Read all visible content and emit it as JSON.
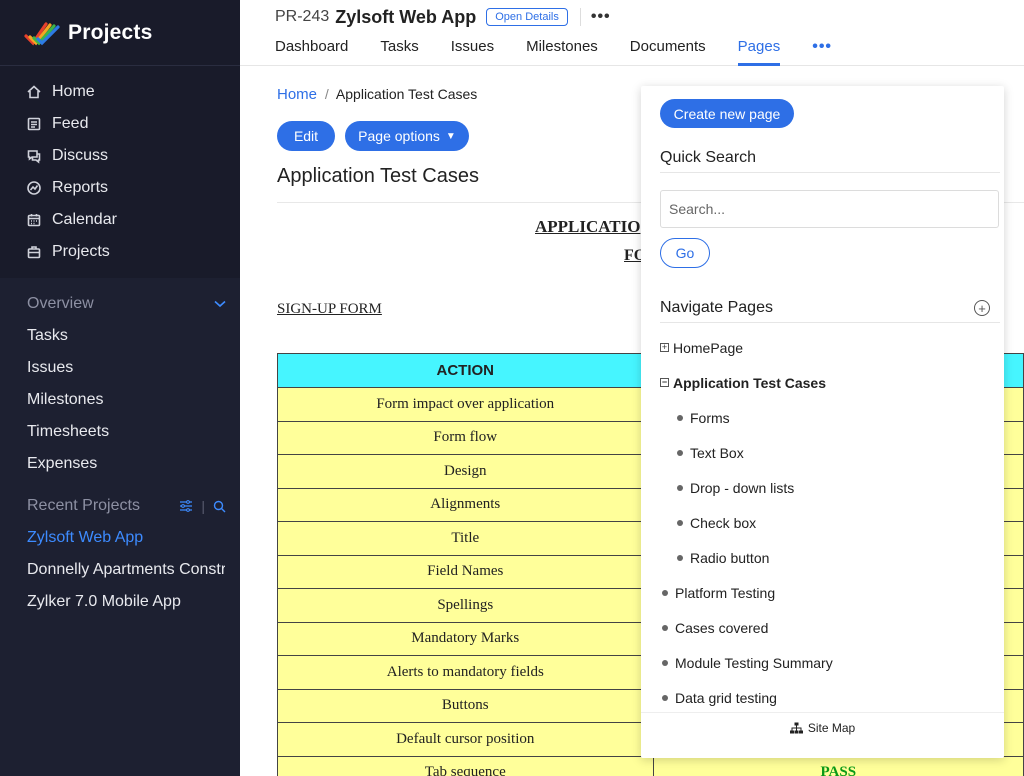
{
  "brand": {
    "title": "Projects"
  },
  "nav": {
    "items": [
      {
        "label": "Home",
        "icon": "home-icon"
      },
      {
        "label": "Feed",
        "icon": "feed-icon"
      },
      {
        "label": "Discuss",
        "icon": "discuss-icon"
      },
      {
        "label": "Reports",
        "icon": "reports-icon"
      },
      {
        "label": "Calendar",
        "icon": "calendar-icon"
      },
      {
        "label": "Projects",
        "icon": "briefcase-icon"
      }
    ]
  },
  "overview": {
    "heading": "Overview",
    "items": [
      "Tasks",
      "Issues",
      "Milestones",
      "Timesheets",
      "Expenses"
    ]
  },
  "recent": {
    "heading": "Recent Projects",
    "items": [
      "Zylsoft Web App",
      "Donnelly Apartments Construction",
      "Zylker 7.0 Mobile App"
    ]
  },
  "header": {
    "project_id": "PR-243",
    "project_name": "Zylsoft Web App",
    "open_details": "Open Details",
    "tabs": [
      "Dashboard",
      "Tasks",
      "Issues",
      "Milestones",
      "Documents",
      "Pages"
    ],
    "active_tab": "Pages"
  },
  "main": {
    "breadcrumb_home": "Home",
    "breadcrumb_sep": "/",
    "breadcrumb_current": "Application Test Cases",
    "edit_label": "Edit",
    "page_options_label": "Page options",
    "page_title": "Application Test Cases"
  },
  "doc": {
    "heading1": "APPLICATIO",
    "heading2": "FO",
    "subheading": "SIGN-UP FORM",
    "table_header": "ACTION",
    "rows": [
      {
        "action": "Form impact over application",
        "result": ""
      },
      {
        "action": "Form flow",
        "result": ""
      },
      {
        "action": "Design",
        "result": ""
      },
      {
        "action": "Alignments",
        "result": ""
      },
      {
        "action": "Title",
        "result": ""
      },
      {
        "action": "Field Names",
        "result": ""
      },
      {
        "action": "Spellings",
        "result": ""
      },
      {
        "action": "Mandatory Marks",
        "result": ""
      },
      {
        "action": "Alerts to mandatory fields",
        "result": ""
      },
      {
        "action": "Buttons",
        "result": ""
      },
      {
        "action": "Default cursor position",
        "result": ""
      },
      {
        "action": "Tab sequence",
        "result": "PASS"
      }
    ]
  },
  "panel": {
    "create_label": "Create new page",
    "quick_search": "Quick Search",
    "search_placeholder": "Search...",
    "go_label": "Go",
    "navigate_pages": "Navigate Pages",
    "tree": [
      {
        "label": "HomePage",
        "type": "expand"
      },
      {
        "label": "Application Test Cases",
        "type": "collapse"
      },
      {
        "label": "Forms",
        "type": "child"
      },
      {
        "label": "Text Box",
        "type": "child"
      },
      {
        "label": "Drop - down lists",
        "type": "child"
      },
      {
        "label": "Check box",
        "type": "child"
      },
      {
        "label": "Radio button",
        "type": "child"
      },
      {
        "label": "Platform Testing",
        "type": "bullet"
      },
      {
        "label": "Cases covered",
        "type": "bullet"
      },
      {
        "label": "Module Testing Summary",
        "type": "bullet"
      },
      {
        "label": "Data grid testing",
        "type": "bullet"
      }
    ],
    "site_map": "Site Map"
  },
  "colors": {
    "sidebar_bg": "#1d2031",
    "accent": "#2e6fe6",
    "table_header": "#46f5ff",
    "table_cell": "#ffff9a",
    "pass": "#0a9a18"
  }
}
